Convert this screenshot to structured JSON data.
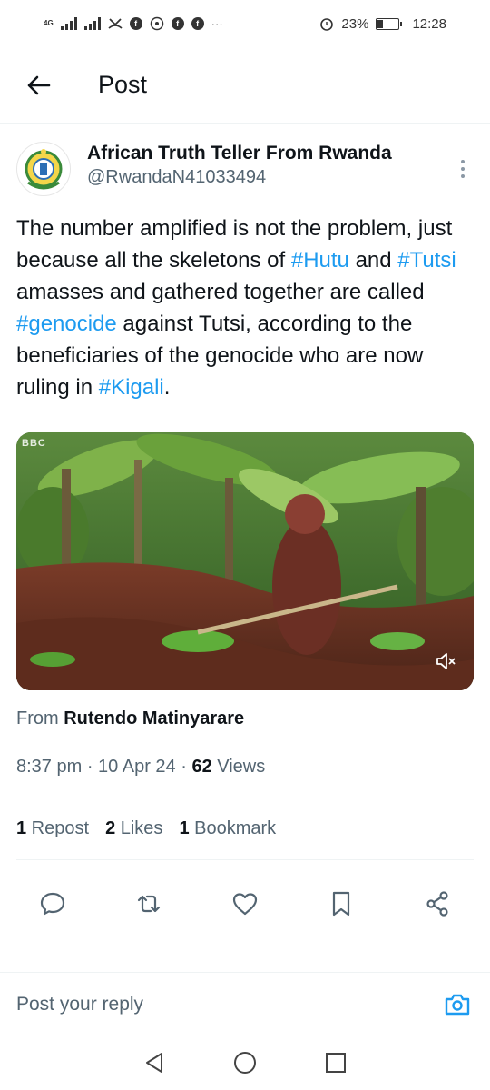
{
  "status_bar": {
    "network_label": "4G",
    "battery_percent": "23%",
    "time": "12:28",
    "more": "···",
    "icons": [
      "signal-icon",
      "signal-icon",
      "missed-call-icon",
      "facebook-icon",
      "wifi-hotspot-icon",
      "facebook-icon",
      "facebook-icon",
      "alarm-icon",
      "battery-icon"
    ]
  },
  "header": {
    "title": "Post",
    "back_icon": "back-arrow-icon"
  },
  "post": {
    "author": {
      "display_name": "African Truth Teller From Rwanda",
      "handle": "@RwandaN41033494",
      "avatar_icon": "rwanda-coat-of-arms"
    },
    "text": {
      "p1": "The number amplified is not the problem, just because all the skeletons of ",
      "tag1": "#Hutu",
      "p2": " and ",
      "tag2": "#Tutsi",
      "p3": " amasses and gathered together are called ",
      "tag3": "#genocide",
      "p4": " against Tutsi, according to the beneficiaries of the genocide who are now ruling in ",
      "tag4": "#Kigali",
      "p5": "."
    },
    "media": {
      "watermark": "BBC",
      "mute_icon": "muted-speaker-icon"
    },
    "from_prefix": "From",
    "from_name": "Rutendo Matinyarare",
    "meta": {
      "time": "8:37 pm",
      "sep": " · ",
      "date": "10 Apr 24",
      "views_count": "62",
      "views_label": " Views"
    },
    "stats": {
      "reposts_count": "1",
      "reposts_label": " Repost",
      "likes_count": "2",
      "likes_label": " Likes",
      "bookmarks_count": "1",
      "bookmarks_label": " Bookmark"
    },
    "actions": [
      "reply-icon",
      "repost-icon",
      "like-icon",
      "bookmark-icon",
      "share-icon"
    ]
  },
  "reply_bar": {
    "placeholder": "Post your reply",
    "camera_icon": "camera-icon"
  },
  "nav_bar": {
    "icons": [
      "nav-back-icon",
      "nav-home-icon",
      "nav-recents-icon"
    ]
  },
  "colors": {
    "link": "#1d9bf0",
    "secondary_text": "#536471",
    "primary_text": "#0f1419",
    "divider": "#eff3f4"
  }
}
